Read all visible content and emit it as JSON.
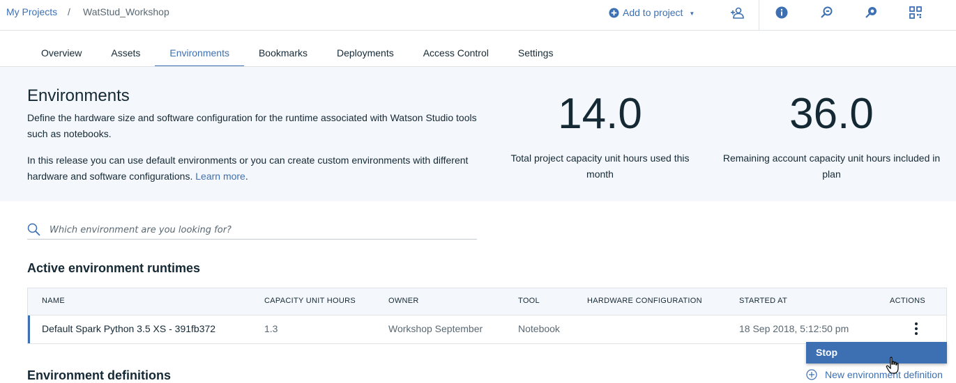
{
  "breadcrumb": {
    "root": "My Projects",
    "separator": "/",
    "current": "WatStud_Workshop"
  },
  "header": {
    "add_to_project": "Add to project",
    "icons": [
      "add-collaborator-icon",
      "info-icon",
      "find-data-icon",
      "community-icon",
      "grid-view-icon"
    ]
  },
  "tabs": [
    {
      "label": "Overview"
    },
    {
      "label": "Assets"
    },
    {
      "label": "Environments"
    },
    {
      "label": "Bookmarks"
    },
    {
      "label": "Deployments"
    },
    {
      "label": "Access Control"
    },
    {
      "label": "Settings"
    }
  ],
  "active_tab": "Environments",
  "banner": {
    "title": "Environments",
    "description1": "Define the hardware size and software configuration for the runtime associated with Watson Studio tools such as notebooks.",
    "description2": "In this release you can use default environments or you can create custom environments with different hardware and software configurations.",
    "learn_more": "Learn more",
    "period": ".",
    "stats": [
      {
        "value": "14.0",
        "label": "Total project capacity unit hours used this month"
      },
      {
        "value": "36.0",
        "label": "Remaining account capacity unit hours included in plan"
      }
    ]
  },
  "search": {
    "placeholder": "Which environment are you looking for?"
  },
  "active_runtimes": {
    "title": "Active environment runtimes",
    "columns": [
      "NAME",
      "CAPACITY UNIT HOURS",
      "OWNER",
      "TOOL",
      "HARDWARE CONFIGURATION",
      "STARTED AT",
      "ACTIONS"
    ],
    "rows": [
      {
        "name": "Default Spark Python 3.5 XS - 391fb372",
        "capacity": "1.3",
        "owner": "Workshop September",
        "tool": "Notebook",
        "hardware": "",
        "started": "18 Sep 2018, 5:12:50 pm"
      }
    ],
    "menu": {
      "stop": "Stop"
    }
  },
  "definitions": {
    "title": "Environment definitions",
    "new_label": "New environment definition"
  },
  "colors": {
    "accent": "#3d70b2",
    "text": "#152935",
    "muted": "#5a6872",
    "banner_bg": "#f4f7fb"
  }
}
